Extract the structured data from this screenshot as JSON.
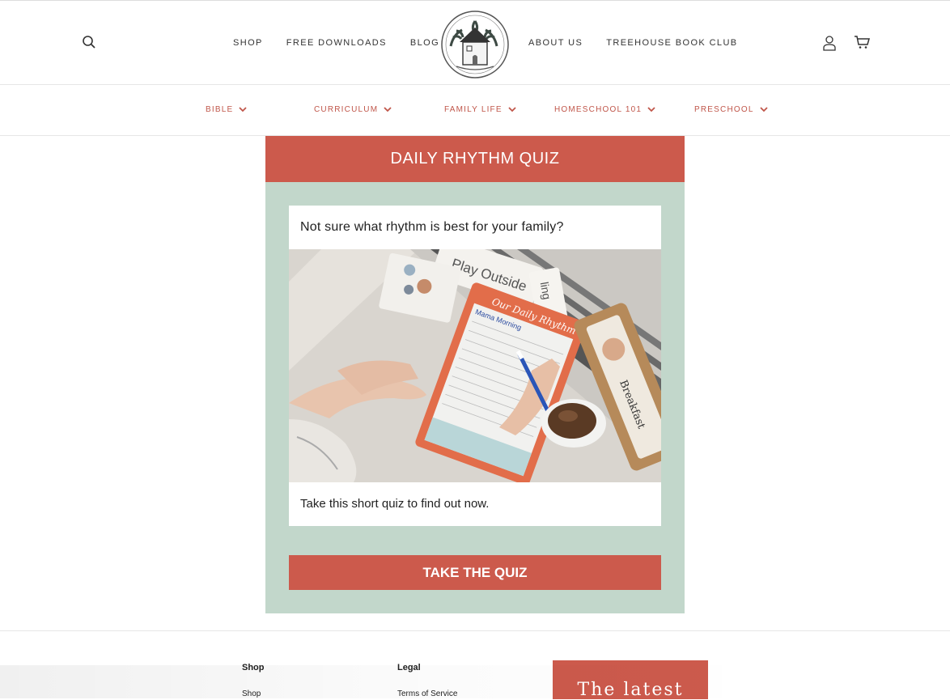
{
  "header": {
    "nav_left": [
      "SHOP",
      "FREE DOWNLOADS",
      "BLOG"
    ],
    "nav_right": [
      "ABOUT US",
      "TREEHOUSE BOOK CLUB"
    ]
  },
  "subnav": [
    "BIBLE",
    "CURRICULUM",
    "FAMILY LIFE",
    "HOMESCHOOL 101",
    "PRESCHOOL"
  ],
  "quiz": {
    "title": "DAILY RHYTHM QUIZ",
    "question": "Not sure what rhythm is best for your family?",
    "subtext": "Take this short quiz to find out now.",
    "button": "TAKE THE QUIZ",
    "photo_labels": {
      "card1": "Play Outside",
      "card2": "ling",
      "board": "Our Daily Rhythm",
      "board_sub": "Mama Morning",
      "breakfast": "Breakfast"
    }
  },
  "footer": {
    "col1_title": "Shop",
    "col1_link": "Shop",
    "col2_title": "Legal",
    "col2_link": "Terms of Service",
    "newsletter": "The latest"
  },
  "colors": {
    "accent": "#cc5a4c",
    "panel": "#c2d7cb"
  }
}
